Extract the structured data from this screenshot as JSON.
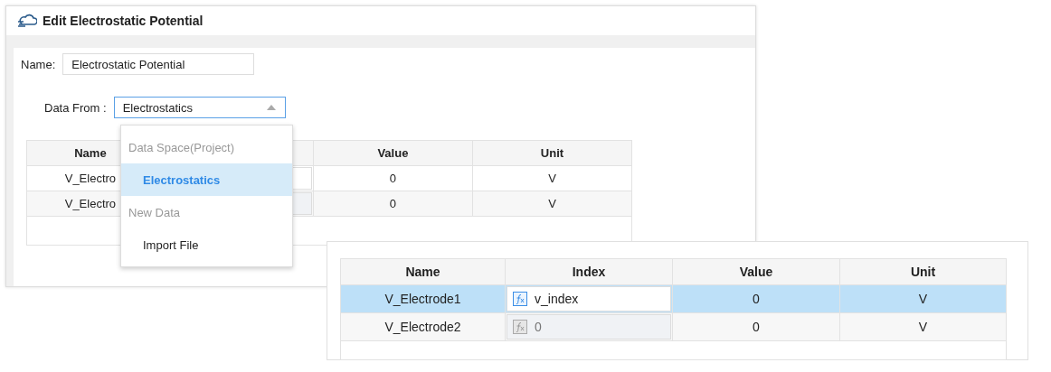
{
  "dialog": {
    "title": "Edit Electrostatic Potential",
    "name_label": "Name:",
    "name_value": "Electrostatic Potential",
    "data_from_label": "Data From :",
    "data_from_value": "Electrostatics",
    "expanded": true,
    "menu": [
      {
        "label": "Data Space(Project)",
        "kind": "group"
      },
      {
        "label": "Electrostatics",
        "kind": "option",
        "selected": true
      },
      {
        "label": "New Data",
        "kind": "group"
      },
      {
        "label": "Import File",
        "kind": "option",
        "selected": false
      }
    ],
    "table": {
      "columns": [
        {
          "label": "Name",
          "kind": "text"
        },
        {
          "kind": "index"
        },
        {
          "label": "Value",
          "kind": "text"
        },
        {
          "label": "Unit",
          "kind": "text"
        }
      ],
      "rows": [
        {
          "name": "V_Electro",
          "selected": false,
          "index_disabled": false,
          "value": "0",
          "unit": "V"
        },
        {
          "name": "V_Electro",
          "selected": false,
          "index_disabled": true,
          "value": "0",
          "unit": "V"
        }
      ]
    }
  },
  "inset_table": {
    "columns": [
      "Name",
      "Index",
      "Value",
      "Unit"
    ],
    "rows": [
      {
        "name": "V_Electrode1",
        "selected": true,
        "index": "v_index",
        "index_disabled": false,
        "value": "0",
        "unit": "V"
      },
      {
        "name": "V_Electrode2",
        "selected": false,
        "index": "0",
        "index_disabled": true,
        "value": "0",
        "unit": "V"
      }
    ]
  }
}
